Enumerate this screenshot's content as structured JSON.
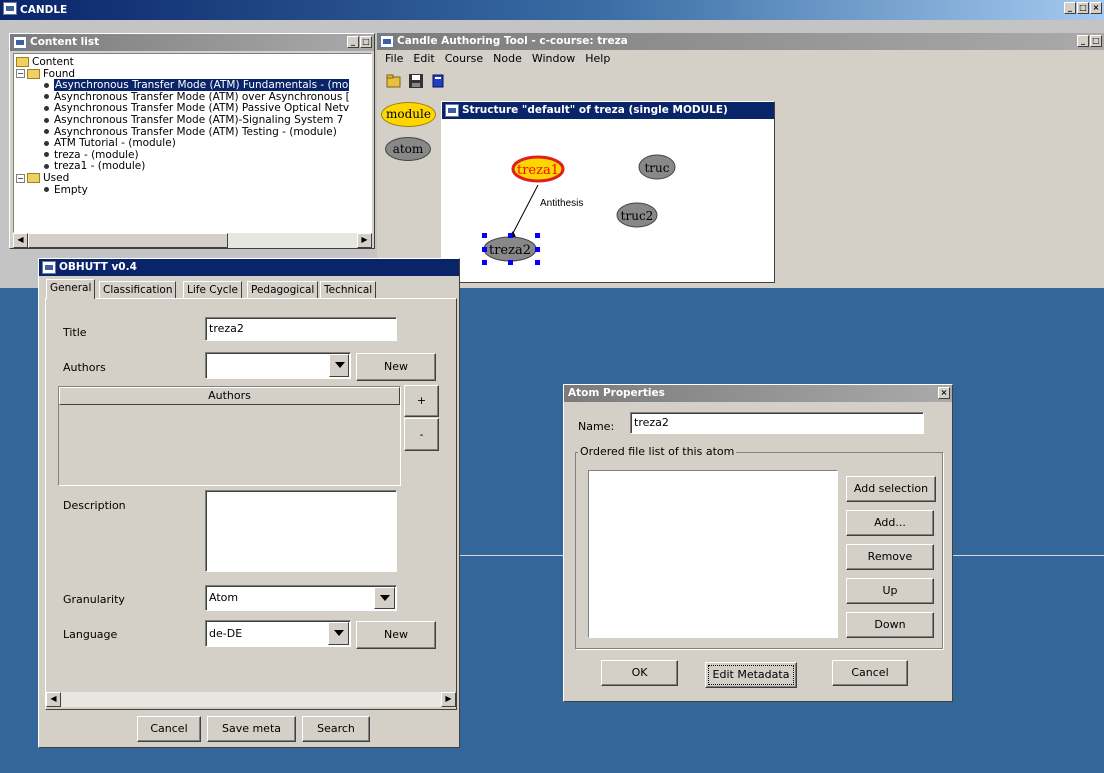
{
  "main_window": {
    "title": "CANDLE"
  },
  "content_list": {
    "title": "Content list",
    "tree": [
      {
        "label": "Content",
        "type": "folder-root"
      },
      {
        "label": "Found",
        "type": "folder"
      },
      {
        "label": "Asynchronous Transfer Mode (ATM) Fundamentals - (mo",
        "type": "item",
        "selected": true
      },
      {
        "label": "Asynchronous Transfer Mode (ATM) over Asynchronous [",
        "type": "item"
      },
      {
        "label": "Asynchronous Transfer Mode (ATM) Passive Optical Netv",
        "type": "item"
      },
      {
        "label": "Asynchronous Transfer Mode (ATM)-Signaling System 7",
        "type": "item"
      },
      {
        "label": "Asynchronous Transfer Mode (ATM) Testing - (module)",
        "type": "item"
      },
      {
        "label": "ATM Tutorial - (module)",
        "type": "item"
      },
      {
        "label": "treza - (module)",
        "type": "item"
      },
      {
        "label": "treza1 - (module)",
        "type": "item"
      },
      {
        "label": "Used",
        "type": "folder"
      },
      {
        "label": "Empty",
        "type": "item"
      }
    ]
  },
  "authoring_tool": {
    "title": "Candle Authoring Tool - c-course: treza",
    "menu": [
      "File",
      "Edit",
      "Course",
      "Node",
      "Window",
      "Help"
    ],
    "palette": [
      "module",
      "atom"
    ]
  },
  "structure_window": {
    "title": "Structure \"default\" of treza (single MODULE)",
    "nodes": [
      "treza1",
      "truc",
      "truc2",
      "treza2"
    ],
    "edge_label": "Antithesis"
  },
  "obhutt": {
    "title": "OBHUTT v0.4",
    "tabs": [
      "General",
      "Classification",
      "Life Cycle",
      "Pedagogical",
      "Technical"
    ],
    "title_label": "Title",
    "title_value": "treza2",
    "authors_label": "Authors",
    "authors_new": "New",
    "authors_table_header": "Authors",
    "plus": "+",
    "minus": "-",
    "description_label": "Description",
    "granularity_label": "Granularity",
    "granularity_value": "Atom",
    "language_label": "Language",
    "language_value": "de-DE",
    "language_new": "New",
    "buttons": {
      "cancel": "Cancel",
      "save": "Save meta",
      "search": "Search"
    }
  },
  "atom_props": {
    "title": "Atom Properties",
    "close": "×",
    "name_label": "Name:",
    "name_value": "treza2",
    "group_label": "Ordered file list of this atom",
    "buttons": {
      "add_selection": "Add selection",
      "add": "Add...",
      "remove": "Remove",
      "up": "Up",
      "down": "Down",
      "ok": "OK",
      "edit_metadata": "Edit Metadata",
      "cancel": "Cancel"
    }
  },
  "colors": {
    "desktop": "#336699",
    "selection": "#0a246a",
    "node_gray": "#888888",
    "node_yellow": "#ffd700",
    "node_red": "#e02020",
    "handle_blue": "#0000ff"
  }
}
